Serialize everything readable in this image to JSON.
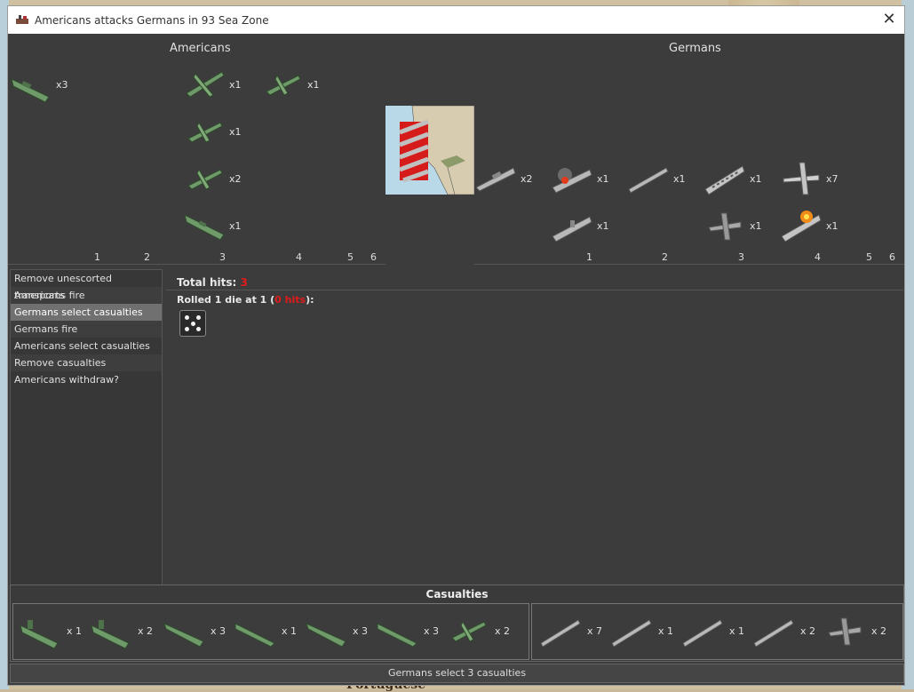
{
  "window": {
    "title": "Americans attacks Germans in 93 Sea Zone"
  },
  "americans": {
    "label": "Americans",
    "units": [
      {
        "kind": "transport",
        "count": "x3"
      },
      {
        "kind": "bomber",
        "count": "x1"
      },
      {
        "kind": "fighter",
        "count": "x1"
      },
      {
        "kind": "fighter",
        "count": "x1"
      },
      {
        "kind": "fighter",
        "count": "x2"
      },
      {
        "kind": "destroyer",
        "count": "x1"
      }
    ],
    "columns": [
      "1",
      "2",
      "3",
      "4",
      "5",
      "6"
    ]
  },
  "germans": {
    "label": "Germans",
    "units": [
      {
        "kind": "transport",
        "count": "x2"
      },
      {
        "kind": "carrier-damaged",
        "count": "x1"
      },
      {
        "kind": "cruiser",
        "count": "x1"
      },
      {
        "kind": "battleship",
        "count": "x1"
      },
      {
        "kind": "bomber",
        "count": "x7"
      },
      {
        "kind": "carrier",
        "count": "x1"
      },
      {
        "kind": "fighter",
        "count": "x1"
      },
      {
        "kind": "battleship-burning",
        "count": "x1"
      }
    ],
    "columns": [
      "1",
      "2",
      "3",
      "4",
      "5",
      "6"
    ]
  },
  "phases": [
    {
      "label": "Remove unescorted transports"
    },
    {
      "label": "Americans fire"
    },
    {
      "label": "Germans select casualties",
      "active": true
    },
    {
      "label": "Germans fire"
    },
    {
      "label": "Americans select casualties"
    },
    {
      "label": "Remove casualties"
    },
    {
      "label": "Americans withdraw?"
    }
  ],
  "log": {
    "total_hits_label": "Total hits:",
    "total_hits_value": "3",
    "rolled_prefix": "Rolled 1 die at 1 (",
    "rolled_hits": "0 hits",
    "rolled_suffix": "):",
    "die_value": 5
  },
  "casualties": {
    "title": "Casualties",
    "american": [
      {
        "kind": "transport",
        "count": "x 1"
      },
      {
        "kind": "transport",
        "count": "x 2"
      },
      {
        "kind": "destroyer",
        "count": "x 3"
      },
      {
        "kind": "submarine",
        "count": "x 1"
      },
      {
        "kind": "destroyer",
        "count": "x 3"
      },
      {
        "kind": "submarine",
        "count": "x 3"
      },
      {
        "kind": "fighter",
        "count": "x 2"
      }
    ],
    "german": [
      {
        "kind": "battleship",
        "count": "x 7"
      },
      {
        "kind": "cruiser",
        "count": "x 1"
      },
      {
        "kind": "cruiser",
        "count": "x 1"
      },
      {
        "kind": "cruiser",
        "count": "x 2"
      },
      {
        "kind": "fighter",
        "count": "x 2"
      }
    ]
  },
  "status": {
    "text": "Germans select 3 casualties"
  },
  "map": {
    "city_label": "Portuguese"
  },
  "colors": {
    "american_unit": "#6f9a6a",
    "german_unit": "#b8b8b8",
    "hits_red": "#e21a1a",
    "active_phase": "#707070"
  }
}
